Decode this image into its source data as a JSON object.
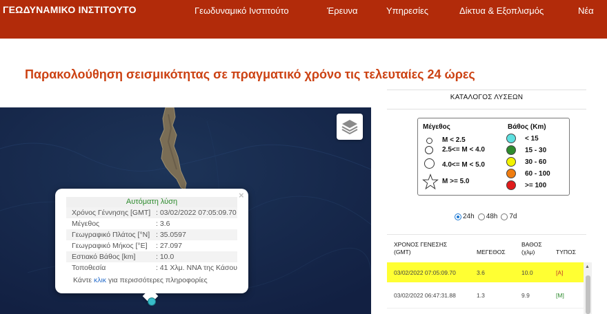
{
  "header": {
    "logo": "ΓΕΩΔΥΝΑΜΙΚΟ ΙΝΣΤΙΤΟΥΤΟ",
    "nav": [
      "Γεωδυναμικό Ινστιτούτο",
      "Έρευνα",
      "Υπηρεσίες",
      "Δίκτυα & Εξοπλισμός",
      "Νέα"
    ]
  },
  "page_title": "Παρακολούθηση σεισμικότητας σε πραγματικό χρόνο τις τελευταίες 24 ώρες",
  "map": {
    "layers_icon": "layers-icon",
    "popup": {
      "header": "Αυτόματη λύση",
      "close": "×",
      "rows": [
        {
          "label": "Χρόνος Γέννησης [GMT]",
          "value": ": 03/02/2022 07:05:09.70"
        },
        {
          "label": "Μέγεθος",
          "value": ": 3.6"
        },
        {
          "label": "Γεωγραφικό Πλάτος [°N]",
          "value": ": 35.0597"
        },
        {
          "label": "Γεωγραφικό Μήκος [°E]",
          "value": ": 27.097"
        },
        {
          "label": "Εστιακό Βάθος [km]",
          "value": ": 10.0"
        },
        {
          "label": "Τοποθεσία",
          "value": ": 41 Χλμ. ΝΝΑ της Κάσου"
        }
      ],
      "more_prefix": "Κάντε ",
      "more_link": "κλικ",
      "more_suffix": " για περισσότερες πληροφορίες"
    }
  },
  "sidebar": {
    "title": "ΚΑΤΑΛΟΓΟΣ ΛΥΣΕΩΝ",
    "legend": {
      "magnitude_title": "Μέγεθος",
      "magnitude_items": [
        "M < 2.5",
        "2.5<= M < 4.0",
        "4.0<= M < 5.0",
        "M >= 5.0"
      ],
      "depth_title": "Βάθος (Km)",
      "depth_items": [
        {
          "label": "< 15",
          "color": "#5ee0e0"
        },
        {
          "label": "15 - 30",
          "color": "#2e8b2e"
        },
        {
          "label": "30 - 60",
          "color": "#f2f200"
        },
        {
          "label": "60 - 100",
          "color": "#f07d10"
        },
        {
          "label": ">= 100",
          "color": "#e01b1b"
        }
      ]
    },
    "time_filter": {
      "options": [
        "24h",
        "48h",
        "7d"
      ],
      "selected": "24h"
    },
    "table": {
      "headers": [
        "ΧΡΟΝΟΣ ΓΕΝΕΣΗΣ (GMT)",
        "ΜΕΓΕΘΟΣ",
        "ΒΑΘΟΣ (χλμ)",
        "ΤΥΠΟΣ"
      ],
      "rows": [
        {
          "time": "03/02/2022 07:05:09.70",
          "mag": "3.6",
          "depth": "10.0",
          "type": "[A]",
          "type_color": "#c0392b"
        },
        {
          "time": "03/02/2022 06:47:31.88",
          "mag": "1.3",
          "depth": "9.9",
          "type": "[M]",
          "type_color": "#2e8b2e"
        }
      ]
    }
  },
  "colors": {
    "header_bg": "#b22b0a",
    "title": "#cc4213",
    "highlight": "#ffff33",
    "marker": "#38bcc9"
  }
}
